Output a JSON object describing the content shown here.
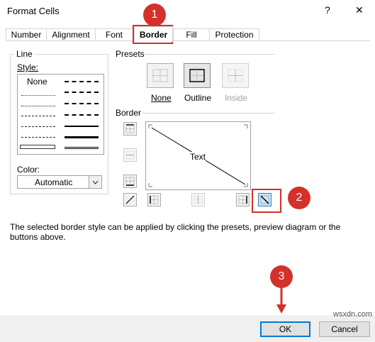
{
  "window": {
    "title": "Format Cells",
    "help_glyph": "?",
    "close_glyph": "✕"
  },
  "tabs": [
    {
      "label": "Number"
    },
    {
      "label": "Alignment"
    },
    {
      "label": "Font"
    },
    {
      "label": "Border",
      "active": true
    },
    {
      "label": "Fill"
    },
    {
      "label": "Protection"
    }
  ],
  "line_section": {
    "heading": "Line",
    "style_label": "Style:",
    "style_none": "None",
    "color_label": "Color:",
    "color_value": "Automatic"
  },
  "presets": {
    "heading": "Presets",
    "labels": [
      "None",
      "Outline",
      "Inside"
    ]
  },
  "border": {
    "heading": "Border",
    "preview_text": "Text"
  },
  "hint": "The selected border style can be applied by clicking the presets, preview diagram or the buttons above.",
  "buttons": {
    "ok": "OK",
    "cancel": "Cancel"
  },
  "annotations": [
    "1",
    "2",
    "3"
  ],
  "watermark": "wsxdn.com",
  "colors": {
    "highlight": "#d4312b",
    "focus": "#0078d7"
  }
}
